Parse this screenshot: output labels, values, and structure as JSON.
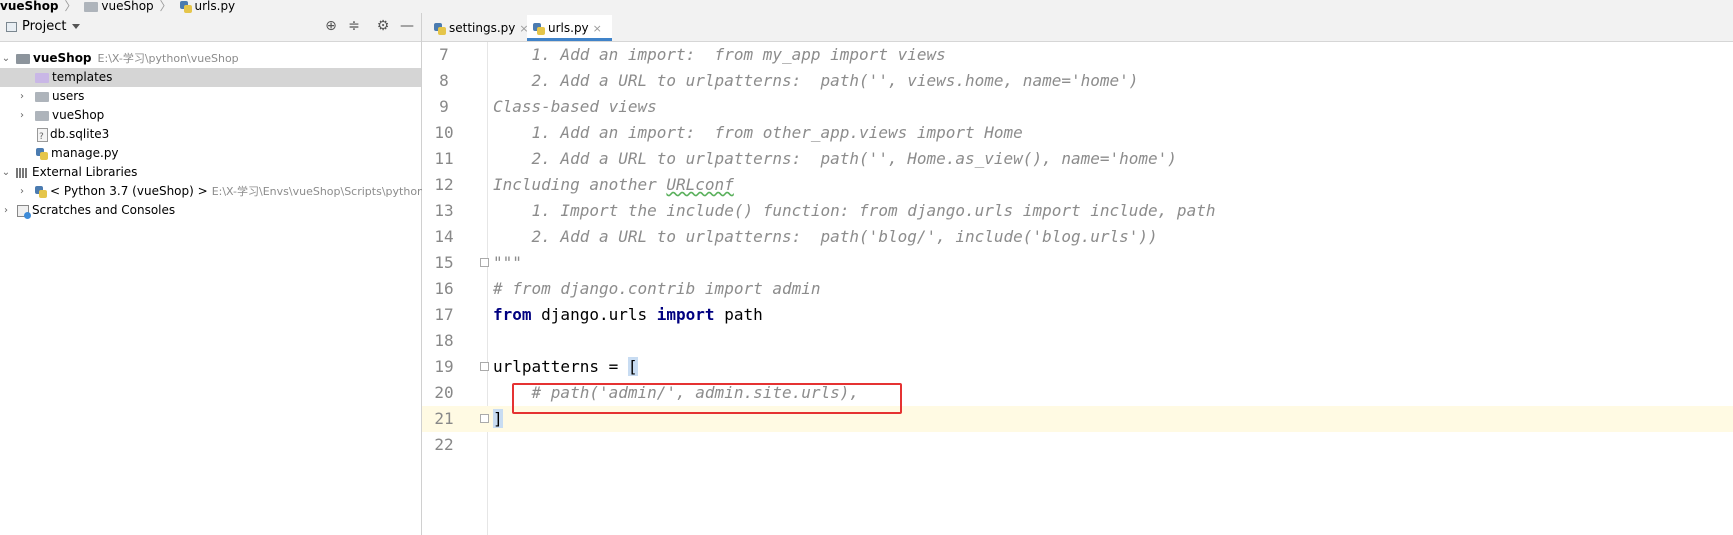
{
  "breadcrumb": [
    "vueShop",
    "vueShop",
    "urls.py"
  ],
  "project_panel": {
    "title": "Project",
    "tree": [
      {
        "label": "vueShop",
        "path": "E:\\X-学习\\python\\vueShop"
      },
      {
        "label": "templates"
      },
      {
        "label": "users"
      },
      {
        "label": "vueShop"
      },
      {
        "label": "db.sqlite3"
      },
      {
        "label": "manage.py"
      },
      {
        "label": "External Libraries"
      },
      {
        "label": "< Python 3.7 (vueShop) >",
        "path": "E:\\X-学习\\Envs\\vueShop\\Scripts\\python.exe"
      },
      {
        "label": "Scratches and Consoles"
      }
    ]
  },
  "tabs": [
    {
      "label": "settings.py",
      "close": "×"
    },
    {
      "label": "urls.py",
      "close": "×"
    }
  ],
  "code_lines": [
    {
      "n": "7",
      "t": "    1. Add an import:  from my_app import views"
    },
    {
      "n": "8",
      "t": "    2. Add a URL to urlpatterns:  path('', views.home, name='home')"
    },
    {
      "n": "9",
      "t": "Class-based views"
    },
    {
      "n": "10",
      "t": "    1. Add an import:  from other_app.views import Home"
    },
    {
      "n": "11",
      "t": "    2. Add a URL to urlpatterns:  path('', Home.as_view(), name='home')"
    },
    {
      "n": "12",
      "a": "Including another ",
      "b": "URLconf"
    },
    {
      "n": "13",
      "t": "    1. Import the include() function: from django.urls import include, path"
    },
    {
      "n": "14",
      "t": "    2. Add a URL to urlpatterns:  path('blog/', include('blog.urls'))"
    },
    {
      "n": "15",
      "t": "\"\"\""
    },
    {
      "n": "16",
      "t": "# from django.contrib import admin"
    },
    {
      "n": "17",
      "k1": "from",
      "m1": " django.urls ",
      "k2": "import",
      "m2": " path"
    },
    {
      "n": "18",
      "t": ""
    },
    {
      "n": "19",
      "a": "urlpatterns = ",
      "b": "["
    },
    {
      "n": "20",
      "t": "    # path('admin/', admin.site.urls),"
    },
    {
      "n": "21",
      "b": "]"
    },
    {
      "n": "22",
      "t": ""
    }
  ]
}
